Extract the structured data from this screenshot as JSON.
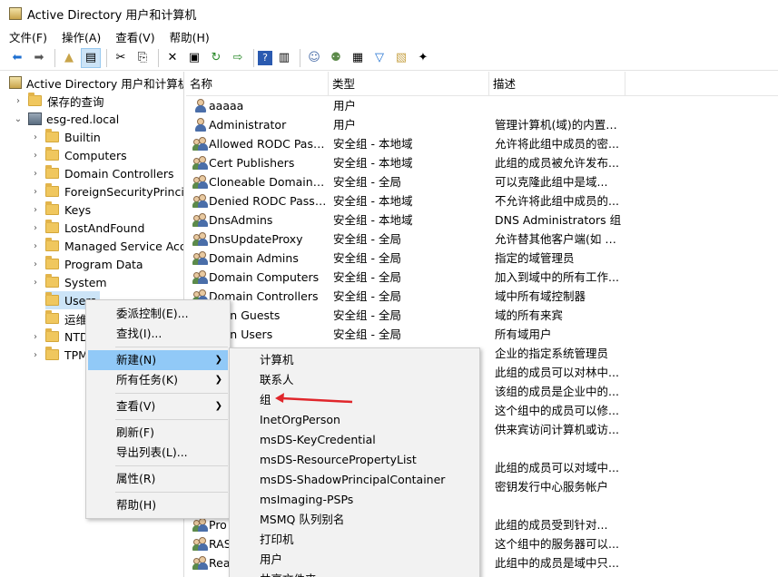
{
  "window": {
    "title": "Active Directory 用户和计算机"
  },
  "menubar": {
    "items": [
      "文件(F)",
      "操作(A)",
      "查看(V)",
      "帮助(H)"
    ]
  },
  "toolbar": {
    "icons": [
      "back-arrow-icon",
      "forward-arrow-icon",
      "up-folder-icon",
      "show-tree-icon",
      "cut-icon",
      "copy-icon",
      "delete-icon",
      "properties-icon",
      "refresh-icon",
      "export-icon",
      "help-icon",
      "console-icon",
      "new-user-icon",
      "new-group-icon",
      "new-ou-icon",
      "filter-icon",
      "find-icon",
      "add-to-group-icon"
    ]
  },
  "tree": {
    "root": "Active Directory 用户和计算机",
    "saved_queries": "保存的查询",
    "domain": "esg-red.local",
    "folders": [
      "Builtin",
      "Computers",
      "Domain Controllers",
      "ForeignSecurityPrincipals",
      "Keys",
      "LostAndFound",
      "Managed Service Accounts",
      "Program Data",
      "System",
      "Users",
      "运维",
      "NTDS Quotas",
      "TPM Devices"
    ],
    "visible_labels": [
      "Builtin",
      "Computers",
      "Domain Controllers",
      "ForeignSecurityPrincipa",
      "Keys",
      "LostAndFound",
      "Managed Service Acco",
      "Program Data",
      "System",
      "Users",
      "运维",
      "NTD",
      "TPM"
    ]
  },
  "list": {
    "columns": [
      "名称",
      "类型",
      "描述"
    ],
    "rows": [
      {
        "name": "aaaaa",
        "type": "用户",
        "desc": "",
        "icon": "user-icon"
      },
      {
        "name": "Administrator",
        "type": "用户",
        "desc": "管理计算机(域)的内置帐...",
        "icon": "user-icon"
      },
      {
        "name": "Allowed RODC Pass...",
        "type": "安全组 - 本地域",
        "desc": "允许将此组中成员的密...",
        "icon": "group-icon"
      },
      {
        "name": "Cert Publishers",
        "type": "安全组 - 本地域",
        "desc": "此组的成员被允许发布...",
        "icon": "group-icon"
      },
      {
        "name": "Cloneable Domain C...",
        "type": "安全组 - 全局",
        "desc": "可以克隆此组中是域...",
        "icon": "group-icon"
      },
      {
        "name": "Denied RODC Passw...",
        "type": "安全组 - 本地域",
        "desc": "不允许将此组中成员的...",
        "icon": "group-icon"
      },
      {
        "name": "DnsAdmins",
        "type": "安全组 - 本地域",
        "desc": "DNS Administrators 组",
        "icon": "group-icon"
      },
      {
        "name": "DnsUpdateProxy",
        "type": "安全组 - 全局",
        "desc": "允许替其他客户端(如 D...",
        "icon": "group-icon"
      },
      {
        "name": "Domain Admins",
        "type": "安全组 - 全局",
        "desc": "指定的域管理员",
        "icon": "group-icon"
      },
      {
        "name": "Domain Computers",
        "type": "安全组 - 全局",
        "desc": "加入到域中的所有工作...",
        "icon": "group-icon"
      },
      {
        "name": "Domain Controllers",
        "type": "安全组 - 全局",
        "desc": "域中所有域控制器",
        "icon": "group-icon"
      },
      {
        "name": "main Guests",
        "type": "安全组 - 全局",
        "desc": "域的所有来宾",
        "icon": "group-icon"
      },
      {
        "name": "main Users",
        "type": "安全组 - 全局",
        "desc": "所有域用户",
        "icon": "group-icon"
      },
      {
        "name": "",
        "type": "",
        "desc": "企业的指定系统管理员",
        "icon": ""
      },
      {
        "name": "",
        "type": "",
        "desc": "此组的成员可以对林中...",
        "icon": ""
      },
      {
        "name": "",
        "type": "",
        "desc": "该组的成员是企业中的...",
        "icon": ""
      },
      {
        "name": "",
        "type": "",
        "desc": "这个组中的成员可以修...",
        "icon": ""
      },
      {
        "name": "",
        "type": "",
        "desc": "供来宾访问计算机或访...",
        "icon": ""
      },
      {
        "name": "",
        "type": "",
        "desc": "",
        "icon": ""
      },
      {
        "name": "",
        "type": "",
        "desc": "此组的成员可以对域中...",
        "icon": ""
      },
      {
        "name": "",
        "type": "",
        "desc": "密钥发行中心服务帐户",
        "icon": ""
      },
      {
        "name": "",
        "type": "",
        "desc": "",
        "icon": ""
      },
      {
        "name": "Pro",
        "type": "",
        "desc": "此组的成员受到针对...",
        "icon": "group-icon"
      },
      {
        "name": "RAS",
        "type": "",
        "desc": "这个组中的服务器可以...",
        "icon": "group-icon"
      },
      {
        "name": "Rea",
        "type": "",
        "desc": "此组中的成员是域中只...",
        "icon": "group-icon"
      }
    ]
  },
  "context_menu": {
    "items": [
      "委派控制(E)...",
      "查找(I)...",
      "新建(N)",
      "所有任务(K)",
      "查看(V)",
      "刷新(F)",
      "导出列表(L)...",
      "属性(R)",
      "帮助(H)"
    ]
  },
  "submenu": {
    "items": [
      "计算机",
      "联系人",
      "组",
      "InetOrgPerson",
      "msDS-KeyCredential",
      "msDS-ResourcePropertyList",
      "msDS-ShadowPrincipalContainer",
      "msImaging-PSPs",
      "MSMQ 队列别名",
      "打印机",
      "用户",
      "共享文件夹"
    ]
  },
  "colors": {
    "highlight": "#91c9f7",
    "selection": "#cce4f7",
    "annotation": "#e0262b"
  }
}
